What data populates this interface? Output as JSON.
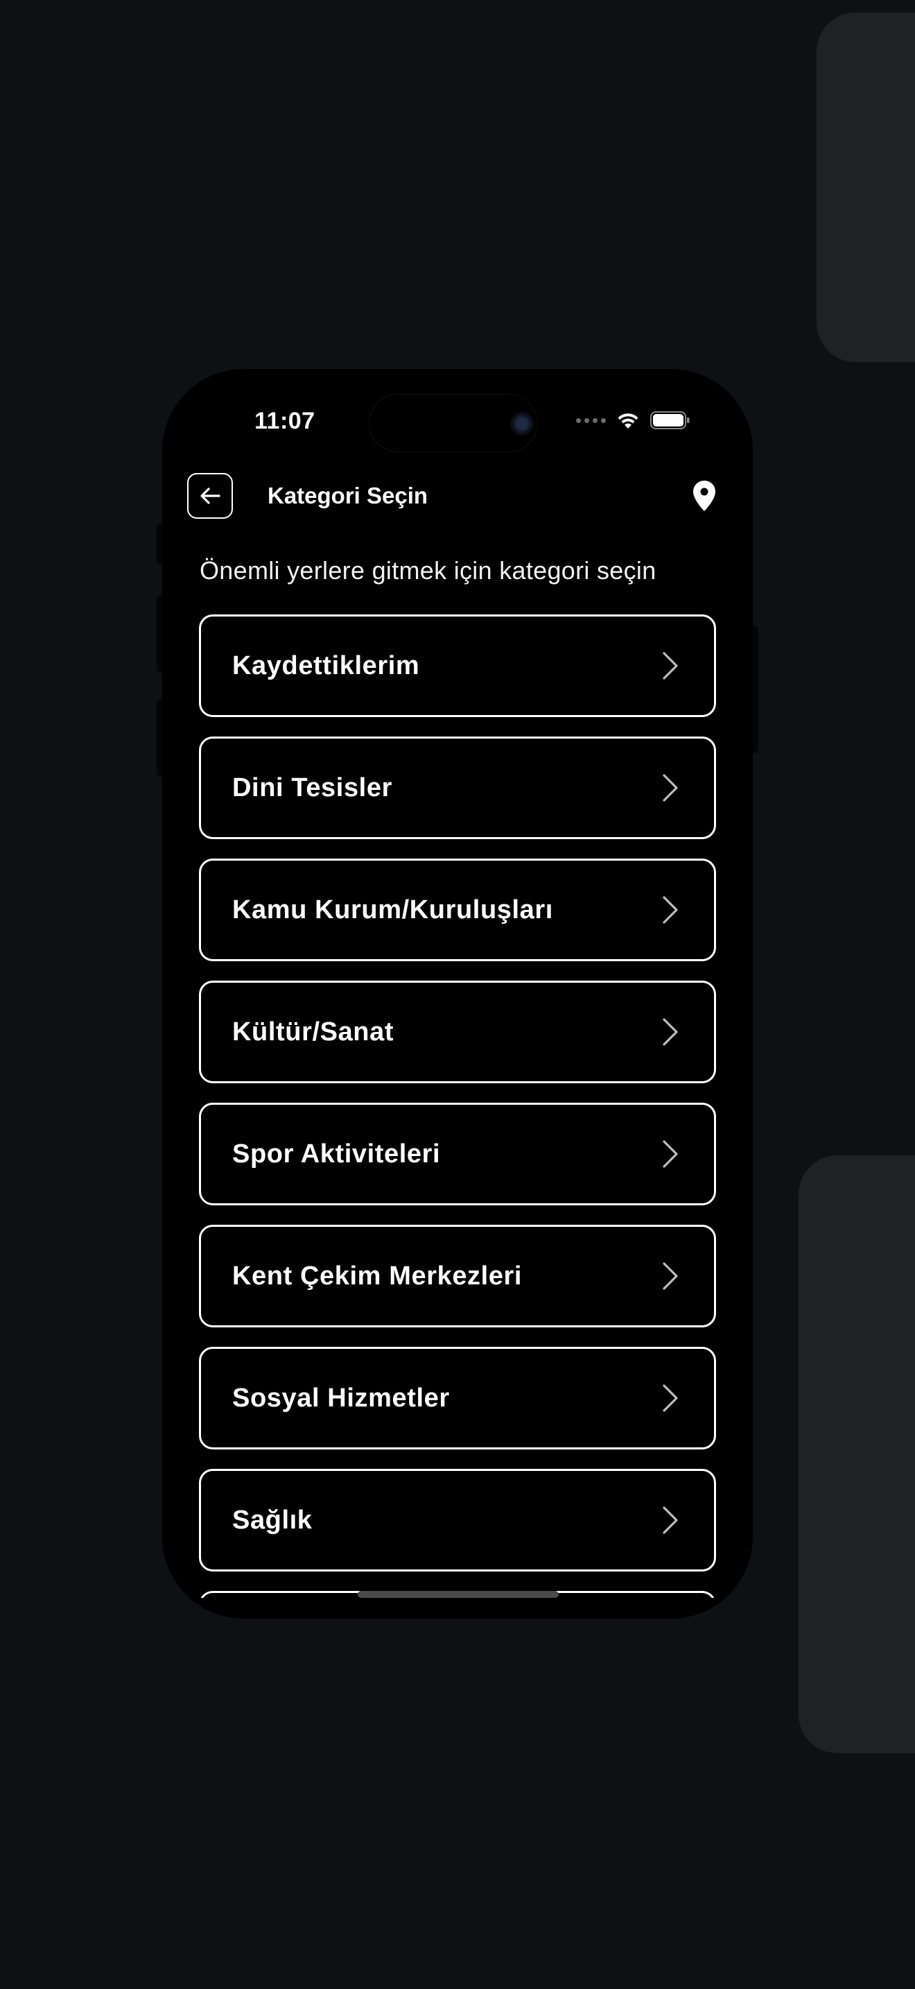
{
  "status_bar": {
    "time": "11:07",
    "icons": [
      "dots-icon",
      "wifi-icon",
      "battery-icon"
    ]
  },
  "header": {
    "back_icon": "arrow-left-icon",
    "title": "Kategori Seçin",
    "location_icon": "map-pin-icon"
  },
  "subtitle": "Önemli yerlere gitmek için kategori seçin",
  "categories": [
    {
      "label": "Kaydettiklerim"
    },
    {
      "label": "Dini Tesisler"
    },
    {
      "label": "Kamu Kurum/Kuruluşları"
    },
    {
      "label": "Kültür/Sanat"
    },
    {
      "label": "Spor Aktiviteleri"
    },
    {
      "label": "Kent Çekim Merkezleri"
    },
    {
      "label": "Sosyal Hizmetler"
    },
    {
      "label": "Sağlık"
    }
  ],
  "colors": {
    "background": "#0f1013",
    "phone": "#000000",
    "accent": "#ffffff",
    "side_card": "#1f2124"
  }
}
